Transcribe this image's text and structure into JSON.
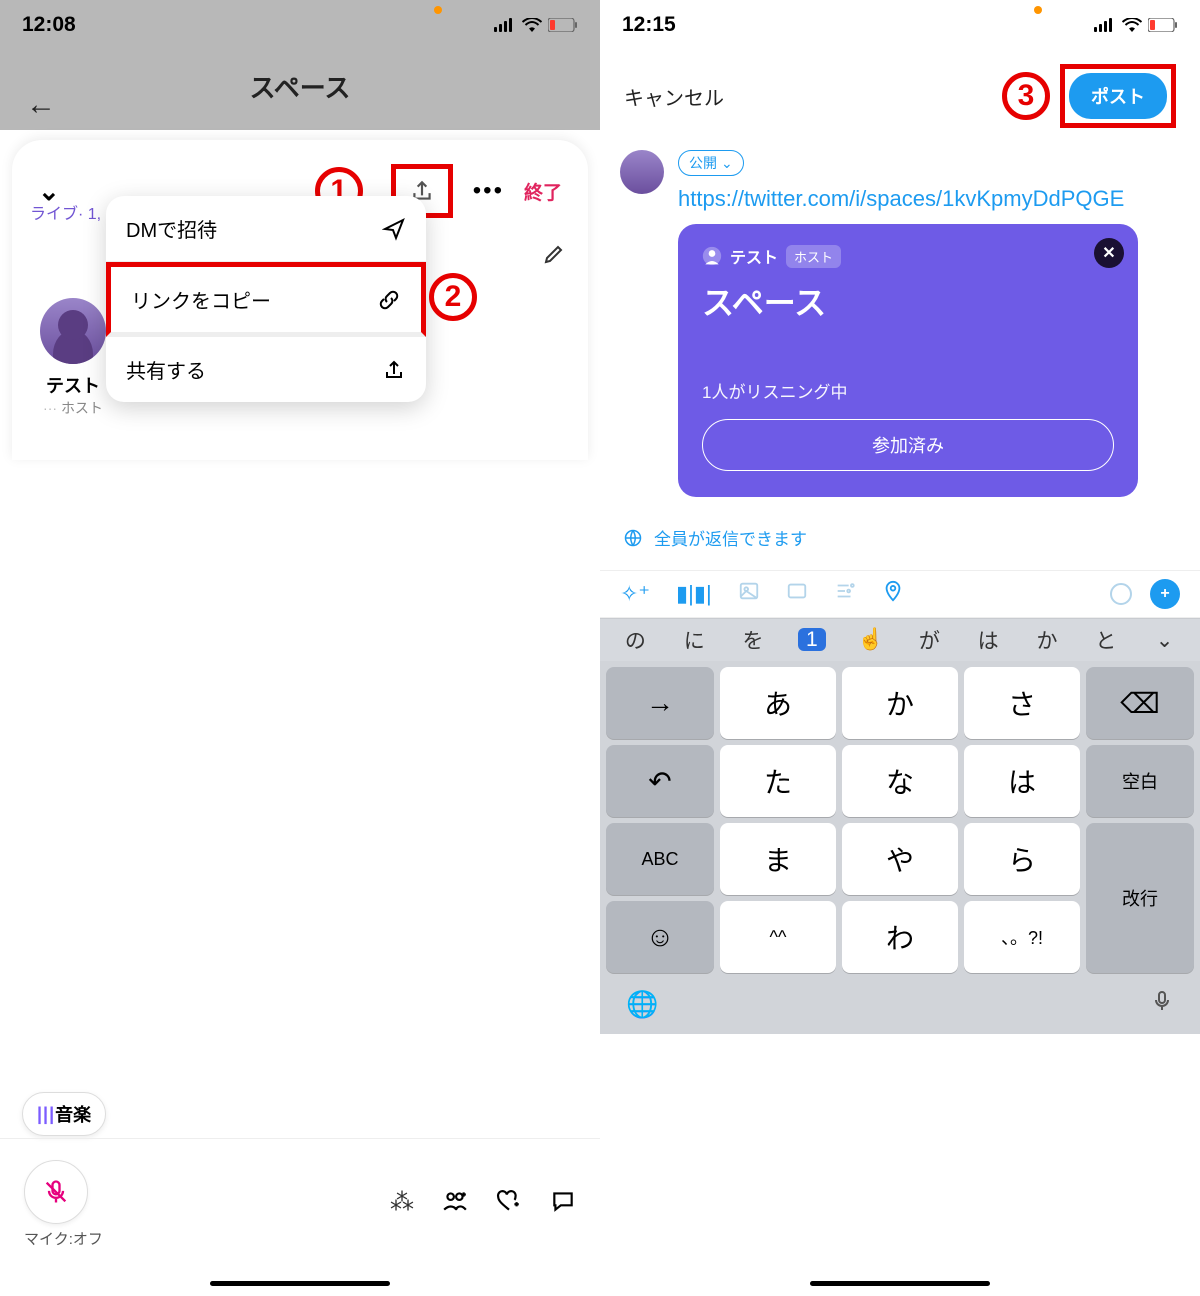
{
  "left": {
    "status_time": "12:08",
    "header_title": "スペース",
    "live_label": "ライブ· 1,",
    "space_name": "テスト",
    "end_label": "終了",
    "menu": {
      "dm_invite": "DMで招待",
      "copy_link": "リンクをコピー",
      "share": "共有する"
    },
    "host_name": "テスト",
    "host_role": "ホスト",
    "music_label": "音楽",
    "mic_label": "マイク:オフ"
  },
  "right": {
    "status_time": "12:15",
    "cancel": "キャンセル",
    "post": "ポスト",
    "visibility": "公開",
    "url": "https://twitter.com/i/spaces/1kvKpmyDdPQGE",
    "card": {
      "host_name": "テスト",
      "host_badge": "ホスト",
      "title": "スペース",
      "listening": "1人がリスニング中",
      "joined": "参加済み"
    },
    "reply_scope": "全員が返信できます",
    "suggestions": [
      "の",
      "に",
      "を",
      "1",
      "☝️",
      "が",
      "は",
      "か",
      "と"
    ],
    "keys": {
      "row1": [
        "あ",
        "か",
        "さ"
      ],
      "row2": [
        "た",
        "な",
        "は"
      ],
      "row3": [
        "ま",
        "や",
        "ら"
      ],
      "row4_center": "わ",
      "abc": "ABC",
      "space": "空白",
      "enter": "改行",
      "kaomoji": "^^",
      "punct": "、。?!"
    }
  },
  "callouts": {
    "one": "1",
    "two": "2",
    "three": "3"
  }
}
